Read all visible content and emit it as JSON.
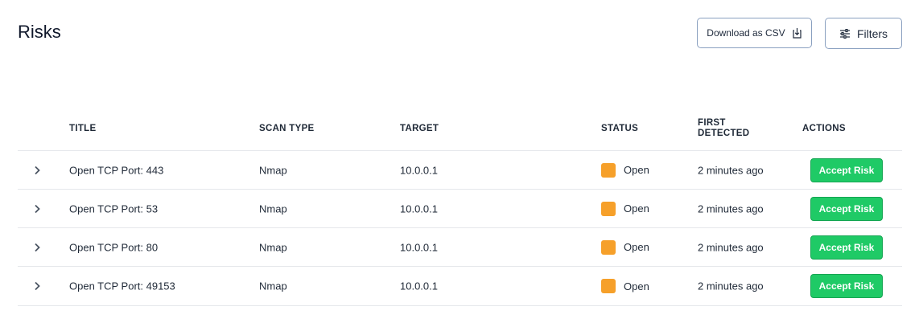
{
  "header": {
    "title": "Risks",
    "download_label": "Download as CSV",
    "filters_label": "Filters"
  },
  "table": {
    "columns": {
      "title": "TITLE",
      "scan_type": "SCAN TYPE",
      "target": "TARGET",
      "status": "STATUS",
      "first_detected_line1": "FIRST",
      "first_detected_line2": "DETECTED",
      "actions": "ACTIONS"
    },
    "rows": [
      {
        "title": "Open TCP Port: 443",
        "scan_type": "Nmap",
        "target": "10.0.0.1",
        "status": "Open",
        "first_detected": "2 minutes ago",
        "action": "Accept Risk"
      },
      {
        "title": "Open TCP Port: 53",
        "scan_type": "Nmap",
        "target": "10.0.0.1",
        "status": "Open",
        "first_detected": "2 minutes ago",
        "action": "Accept Risk"
      },
      {
        "title": "Open TCP Port: 80",
        "scan_type": "Nmap",
        "target": "10.0.0.1",
        "status": "Open",
        "first_detected": "2 minutes ago",
        "action": "Accept Risk"
      },
      {
        "title": "Open TCP Port: 49153",
        "scan_type": "Nmap",
        "target": "10.0.0.1",
        "status": "Open",
        "first_detected": "2 minutes ago",
        "action": "Accept Risk"
      }
    ]
  },
  "icons": {
    "download": "download-icon",
    "filters": "sliders-icon",
    "expand": "chevron-right-icon"
  },
  "colors": {
    "status_open": "#f6a02a",
    "accept_button": "#1fca66",
    "button_border": "#8aa0c0"
  }
}
